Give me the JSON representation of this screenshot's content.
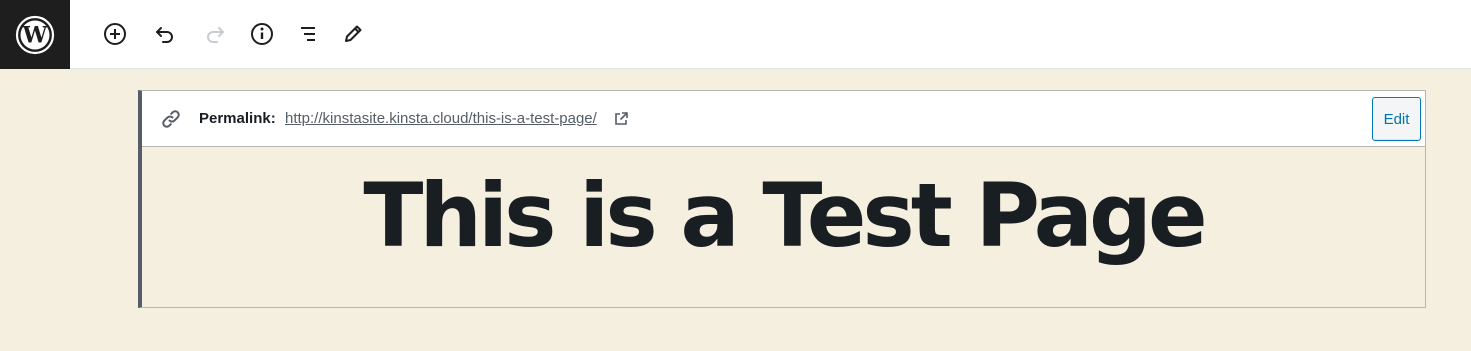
{
  "toolbar": {
    "logo_icon": "wordpress-logo-icon",
    "tools": [
      {
        "name": "add-block-button",
        "icon": "plus-circle-icon"
      },
      {
        "name": "undo-button",
        "icon": "undo-icon"
      },
      {
        "name": "redo-button",
        "icon": "redo-icon",
        "disabled": true
      },
      {
        "name": "content-info-button",
        "icon": "info-icon"
      },
      {
        "name": "block-navigation-button",
        "icon": "list-icon"
      },
      {
        "name": "edit-mode-button",
        "icon": "pencil-icon"
      }
    ]
  },
  "permalink": {
    "icon": "link-icon",
    "label": "Permalink:",
    "url": "http://kinstasite.kinsta.cloud/this-is-a-test-page/",
    "external_icon": "external-link-icon",
    "edit_label": "Edit"
  },
  "post": {
    "title": "This is a Test Page"
  },
  "colors": {
    "background": "#f5efe0",
    "toolbar_bg": "#ffffff",
    "logo_bg": "#1e1e1e",
    "accent": "#0073aa",
    "text": "#191e23"
  }
}
